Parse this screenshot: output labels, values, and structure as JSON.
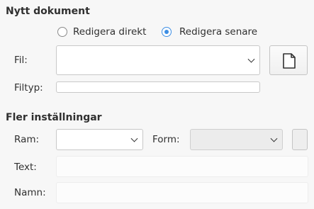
{
  "new_document": {
    "title": "Nytt dokument",
    "edit_now": {
      "label": "Redigera direkt",
      "selected": false
    },
    "edit_later": {
      "label": "Redigera senare",
      "selected": true
    },
    "file_label": "Fil:",
    "file_value": "",
    "filetype_label": "Filtyp:",
    "filetype_value": "",
    "new_file_icon": "document-icon"
  },
  "more_settings": {
    "title": "Fler inställningar",
    "frame_label": "Ram:",
    "frame_value": "",
    "form_label": "Form:",
    "form_value": "",
    "text_label": "Text:",
    "text_value": "",
    "name_label": "Namn:",
    "name_value": ""
  },
  "colors": {
    "accent": "#3d8ee4"
  }
}
